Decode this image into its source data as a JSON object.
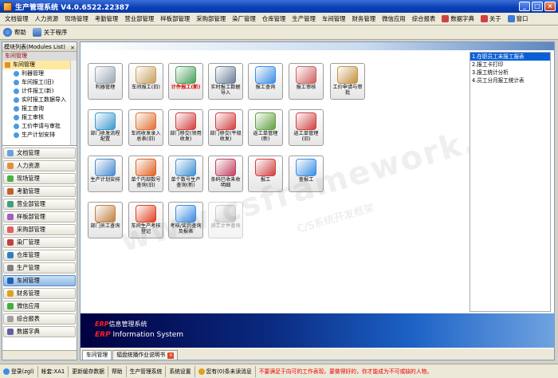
{
  "window": {
    "title": "生产管理系统 V4.0.6522.22387"
  },
  "menu": [
    {
      "label": "文档管理",
      "color": "#3a7bd5"
    },
    {
      "label": "人力资源",
      "color": "#3a7bd5"
    },
    {
      "label": "现场管理",
      "color": "#3a7bd5"
    },
    {
      "label": "考勤管理",
      "color": "#3a7bd5"
    },
    {
      "label": "营业部管理",
      "color": "#3a7bd5"
    },
    {
      "label": "样板部管理",
      "color": "#3a7bd5"
    },
    {
      "label": "采购部管理",
      "color": "#3a7bd5"
    },
    {
      "label": "染厂管理",
      "color": "#3a7bd5"
    },
    {
      "label": "仓库管理",
      "color": "#3a7bd5"
    },
    {
      "label": "生产管理",
      "color": "#3a7bd5"
    },
    {
      "label": "车间管理",
      "color": "#3a7bd5"
    },
    {
      "label": "财务管理",
      "color": "#3a7bd5"
    },
    {
      "label": "微信应用",
      "color": "#3a7bd5"
    },
    {
      "label": "综合报表",
      "color": "#3a7bd5"
    },
    {
      "label": "数据字典",
      "color": "#d04040"
    },
    {
      "label": "关于",
      "color": "#d04040"
    },
    {
      "label": "窗口",
      "color": "#3a7bd5"
    }
  ],
  "toolbar": {
    "help": "帮助",
    "about": "关于程序"
  },
  "left": {
    "header": "模块列表(Modules List)",
    "pin": "×",
    "tree_title": "车间管理",
    "tree_root": "车间管理",
    "tree_items": [
      "利器管理",
      "车间报工(旧)",
      "计件报工(新)",
      "实时报工数据导入",
      "报工查询",
      "报工审核",
      "工价申请与审批",
      "生产计划安排"
    ],
    "modules": [
      {
        "label": "文档管理",
        "color": "#6aa0e0"
      },
      {
        "label": "人力资源",
        "color": "#e09040"
      },
      {
        "label": "现场管理",
        "color": "#4ab04a"
      },
      {
        "label": "考勤管理",
        "color": "#c06030"
      },
      {
        "label": "营业部管理",
        "color": "#40a080"
      },
      {
        "label": "样板部管理",
        "color": "#a060c0"
      },
      {
        "label": "采购部管理",
        "color": "#e06060"
      },
      {
        "label": "染厂管理",
        "color": "#c04040"
      },
      {
        "label": "仓库管理",
        "color": "#3080c0"
      },
      {
        "label": "生产管理",
        "color": "#808080"
      },
      {
        "label": "车间管理",
        "color": "#2060b0"
      },
      {
        "label": "财务管理",
        "color": "#e0a020"
      },
      {
        "label": "微信应用",
        "color": "#40b040"
      },
      {
        "label": "综合报表",
        "color": "#a0a0a0"
      },
      {
        "label": "数据字典",
        "color": "#6060a0"
      }
    ]
  },
  "tiles": [
    {
      "label": "利器管理",
      "icon": "paperclip-icon",
      "color": "#9aa7b3",
      "red": false,
      "disabled": false
    },
    {
      "label": "车间报工(旧)",
      "icon": "clipboard-icon",
      "color": "#c8a060",
      "red": false,
      "disabled": false
    },
    {
      "label": "计件报工(新)",
      "icon": "cube-stack-icon",
      "color": "#4a9e5a",
      "red": true,
      "disabled": false
    },
    {
      "label": "实时报工数据导入",
      "icon": "database-import-icon",
      "color": "#6a7e98",
      "red": false,
      "disabled": false
    },
    {
      "label": "报工查询",
      "icon": "magnifier-icon",
      "color": "#3a8ee6",
      "red": false,
      "disabled": false
    },
    {
      "label": "报工审核",
      "icon": "monitor-check-icon",
      "color": "#d06060",
      "red": false,
      "disabled": false
    },
    {
      "label": "工价申请与审批",
      "icon": "person-approve-icon",
      "color": "#c09040",
      "red": false,
      "disabled": false
    },
    {
      "label": "部门收发流程配置",
      "icon": "monitor-gear-icon",
      "color": "#3a9ad0",
      "red": false,
      "disabled": false
    },
    {
      "label": "车间收发录入总表(旧)",
      "icon": "house-network-icon",
      "color": "#e07030",
      "red": false,
      "disabled": false
    },
    {
      "label": "部门移交(领用收发)",
      "icon": "transfer-ab-icon",
      "color": "#d04040",
      "red": false,
      "disabled": false
    },
    {
      "label": "部门移交(平级收发)",
      "icon": "arrow-ab-icon",
      "color": "#d04040",
      "red": false,
      "disabled": false
    },
    {
      "label": "返工单管理(新)",
      "icon": "rework-new-icon",
      "color": "#60a040",
      "red": false,
      "disabled": false
    },
    {
      "label": "返工单管理(旧)",
      "icon": "rework-old-icon",
      "color": "#d04040",
      "red": false,
      "disabled": false
    },
    {
      "label": "生产计划安排",
      "icon": "calendar-icon",
      "color": "#4a8ad0",
      "red": false,
      "disabled": false
    },
    {
      "label": "单个内部数号查询(旧)",
      "icon": "pie-chart-icon",
      "color": "#e06020",
      "red": false,
      "disabled": false
    },
    {
      "label": "单个数号生产查询(新)",
      "icon": "people-search-icon",
      "color": "#4090d0",
      "red": false,
      "disabled": false
    },
    {
      "label": "条码已收未收明细",
      "icon": "barcode-people-icon",
      "color": "#c04060",
      "red": false,
      "disabled": false
    },
    {
      "label": "报工",
      "icon": "report-check-icon",
      "color": "#d04040",
      "red": false,
      "disabled": false
    },
    {
      "label": "查报工",
      "icon": "search-report-icon",
      "color": "#3a8ee6",
      "red": false,
      "disabled": false
    },
    {
      "label": "部门员工查询",
      "icon": "employee-icon",
      "color": "#c08040",
      "red": false,
      "disabled": false
    },
    {
      "label": "车间生产考核登记",
      "icon": "shield-heart-icon",
      "color": "#e04020",
      "red": false,
      "disabled": false
    },
    {
      "label": "考核/奖罚查询及报表",
      "icon": "magnifier-icon",
      "color": "#3a8ee6",
      "red": false,
      "disabled": false
    },
    {
      "label": "员工计件查询",
      "icon": "grid-icon",
      "color": "#8a8a8a",
      "red": false,
      "disabled": true
    }
  ],
  "links": [
    "1.在职员工未报工报表",
    "2.报工卡打印",
    "3.报工统计分析",
    "4.员工分月报工统计表"
  ],
  "banner": {
    "l1_erp": "ERP",
    "l1_rest": "信息管理系统",
    "l2_erp": "ERP",
    "l2_rest": " Information System"
  },
  "tabs": [
    {
      "label": "车间管理",
      "closable": false
    },
    {
      "label": "辐盘统播作业说明书",
      "closable": true
    }
  ],
  "tab_close": "×",
  "watermark": {
    "big": "www.csframework.com",
    "small": "C/S系统开发框架"
  },
  "status": {
    "login": "登录(zgl)",
    "account": "帐套:XA1",
    "update": "更新缓存数据",
    "help": "帮助",
    "system": "生产管理系统",
    "settings": "系统设置",
    "messages": "您有(0)条未读消息",
    "warning": "不要满足于向可的工作表现，要做得好的，你才能成为不可或缺的人物。"
  }
}
